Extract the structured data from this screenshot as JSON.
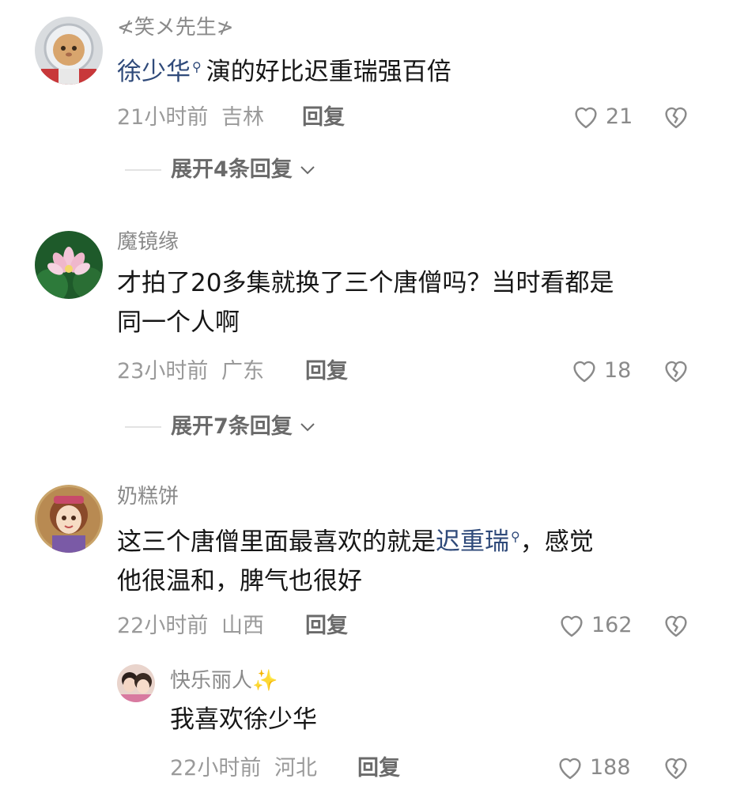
{
  "comments": [
    {
      "username": "≮笑メ先生≯",
      "text_link": "徐少华",
      "text": "演的好比迟重瑞强百倍",
      "time": "21小时前",
      "location": "吉林",
      "reply_label": "回复",
      "likes": "21",
      "expand": "展开4条回复"
    },
    {
      "username": "魔镜缘",
      "text_line1": "才拍了20多集就换了三个唐僧吗？当时看都是",
      "text_line2": "同一个人啊",
      "time": "23小时前",
      "location": "广东",
      "reply_label": "回复",
      "likes": "18",
      "expand": "展开7条回复"
    },
    {
      "username": "奶糕饼",
      "text_pre": "这三个唐僧里面最喜欢的就是",
      "text_link": "迟重瑞",
      "text_post": "，感觉",
      "text_line2": "他很温和，脾气也很好",
      "time": "22小时前",
      "location": "山西",
      "reply_label": "回复",
      "likes": "162"
    }
  ],
  "reply": {
    "username": "快乐丽人",
    "username_emoji": "✨",
    "text": "我喜欢徐少华",
    "time": "22小时前",
    "location": "河北",
    "reply_label": "回复",
    "likes": "188"
  },
  "icons": {
    "heart": "heart-icon",
    "dislike": "broken-heart-icon",
    "search": "search-icon",
    "chevron": "chevron-down-icon"
  },
  "colors": {
    "link": "#2f4a7a",
    "meta": "#9a9a9a",
    "text": "#161616"
  }
}
